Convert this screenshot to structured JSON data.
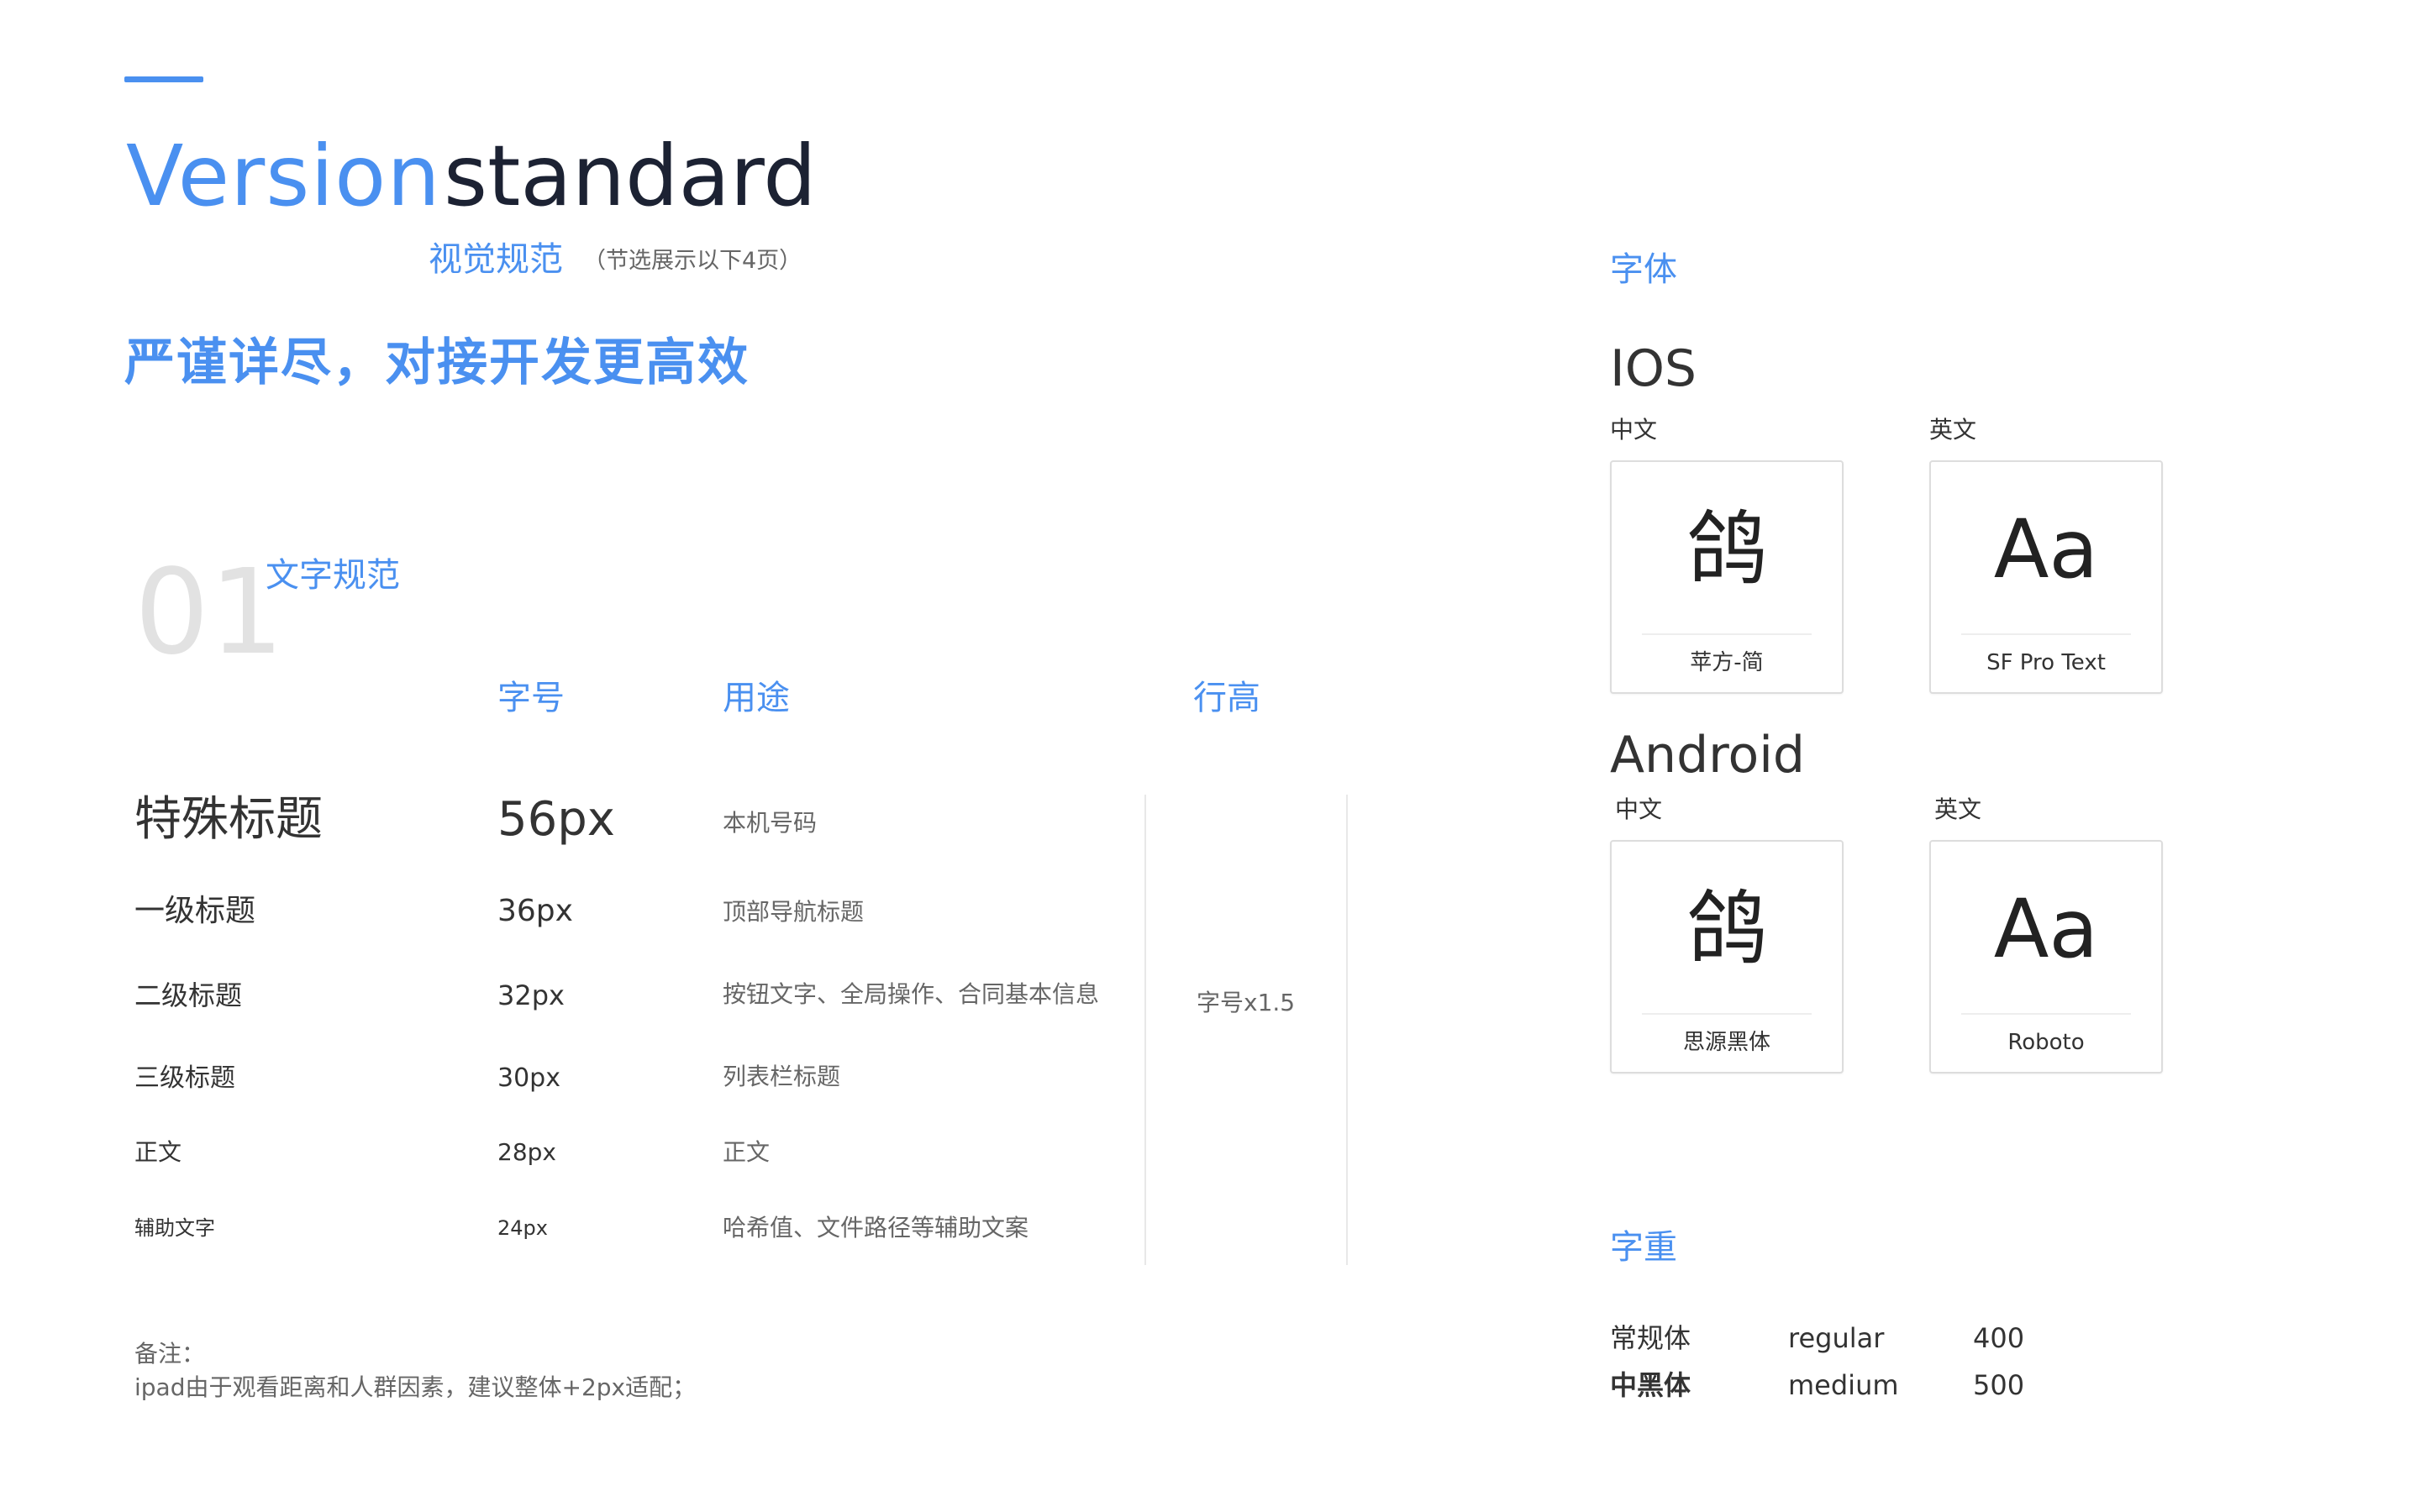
{
  "colors": {
    "accent": "#4a90f0",
    "title_dark": "#1c2233",
    "text": "#333333",
    "muted": "#666666",
    "section_number": "#e2e2e2"
  },
  "header": {
    "title_part1": "Version",
    "title_part2": "standard",
    "subtitle": "视觉规范",
    "subtitle_note": "（节选展示以下4页）",
    "slogan": "严谨详尽，对接开发更高效"
  },
  "typography_section": {
    "number": "01",
    "title": "文字规范",
    "columns": {
      "size": "字号",
      "use": "用途",
      "line_height": "行高"
    },
    "rows": [
      {
        "name": "特殊标题",
        "size": "56px",
        "use": "本机号码"
      },
      {
        "name": "一级标题",
        "size": "36px",
        "use": "顶部导航标题"
      },
      {
        "name": "二级标题",
        "size": "32px",
        "use": "按钮文字、全局操作、合同基本信息"
      },
      {
        "name": "三级标题",
        "size": "30px",
        "use": "列表栏标题"
      },
      {
        "name": "正文",
        "size": "28px",
        "use": "正文"
      },
      {
        "name": "辅助文字",
        "size": "24px",
        "use": "哈希值、文件路径等辅助文案"
      }
    ],
    "line_height_value": "字号x1.5",
    "note_label": "备注：",
    "note_text": "ipad由于观看距离和人群因素，建议整体+2px适配；"
  },
  "fonts": {
    "heading": "字体",
    "ios": {
      "label": "IOS",
      "chinese_label": "中文",
      "english_label": "英文",
      "chinese_glyph": "鸽",
      "chinese_font": "苹方-简",
      "english_glyph": "Aa",
      "english_font": "SF Pro Text"
    },
    "android": {
      "label": "Android",
      "chinese_label": "中文",
      "english_label": "英文",
      "chinese_glyph": "鸽",
      "chinese_font": "思源黑体",
      "english_glyph": "Aa",
      "english_font": "Roboto"
    }
  },
  "weights": {
    "heading": "字重",
    "rows": [
      {
        "cn": "常规体",
        "en": "regular",
        "value": "400"
      },
      {
        "cn": "中黑体",
        "en": "medium",
        "value": "500"
      }
    ]
  }
}
